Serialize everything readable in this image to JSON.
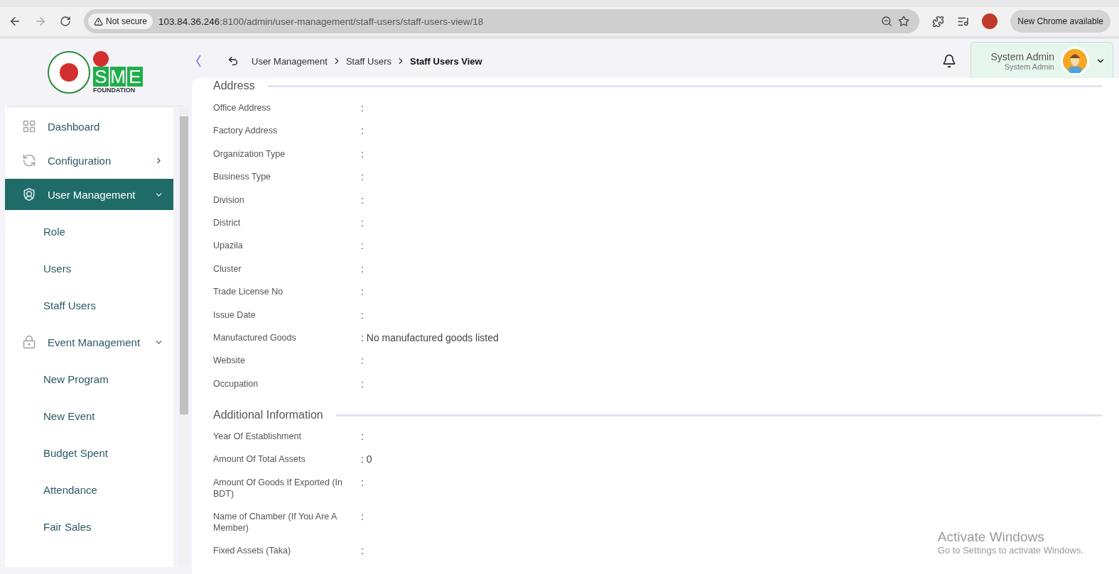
{
  "browser": {
    "security": "Not secure",
    "url_host": "103.84.36.246",
    "url_path": ":8100/admin/user-management/staff-users/staff-users-view/18",
    "update": "New Chrome available"
  },
  "logo": {
    "letters": [
      "S",
      "M",
      "E"
    ],
    "caption": "FOUNDATION"
  },
  "sidebar": {
    "items": [
      {
        "label": "Dashboard",
        "selected": false
      },
      {
        "label": "Configuration",
        "selected": false,
        "expanded": false
      },
      {
        "label": "User Management",
        "selected": true,
        "expanded": true,
        "children": [
          {
            "label": "Role"
          },
          {
            "label": "Users"
          },
          {
            "label": "Staff Users"
          }
        ]
      },
      {
        "label": "Event Management",
        "selected": false,
        "expanded": true,
        "children": [
          {
            "label": "New Program"
          },
          {
            "label": "New Event"
          },
          {
            "label": "Budget Spent"
          },
          {
            "label": "Attendance"
          },
          {
            "label": "Fair Sales"
          }
        ]
      }
    ]
  },
  "breadcrumb": [
    {
      "label": "User Management",
      "current": false
    },
    {
      "label": "Staff Users",
      "current": false
    },
    {
      "label": "Staff Users View",
      "current": true
    }
  ],
  "user": {
    "name": "System Admin",
    "role": "System Admin"
  },
  "sections": [
    {
      "title": "Address",
      "fields": [
        {
          "label": "Office Address",
          "value": ":"
        },
        {
          "label": "Factory Address",
          "value": ":"
        },
        {
          "label": "Organization Type",
          "value": ":"
        },
        {
          "label": "Business Type",
          "value": ":"
        },
        {
          "label": "Division",
          "value": ":"
        },
        {
          "label": "District",
          "value": ":"
        },
        {
          "label": "Upazila",
          "value": ":"
        },
        {
          "label": "Cluster",
          "value": ":"
        },
        {
          "label": "Trade License No",
          "value": ":"
        },
        {
          "label": "Issue Date",
          "value": ":"
        },
        {
          "label": "Manufactured Goods",
          "value": ": No manufactured goods listed"
        },
        {
          "label": "Website",
          "value": ":"
        },
        {
          "label": "Occupation",
          "value": ":"
        }
      ]
    },
    {
      "title": "Additional Information",
      "fields": [
        {
          "label": "Year Of Establishment",
          "value": ":"
        },
        {
          "label": "Amount Of Total Assets",
          "value": ": 0"
        },
        {
          "label": "Amount Of Goods If Exported (In BDT)",
          "value": ":"
        },
        {
          "label": "Name of Chamber (If You Are A Member)",
          "value": ":"
        },
        {
          "label": "Fixed Assets (Taka)",
          "value": ":"
        }
      ]
    }
  ],
  "os_notice": {
    "title": "Activate Windows",
    "text": "Go to Settings to activate Windows."
  }
}
